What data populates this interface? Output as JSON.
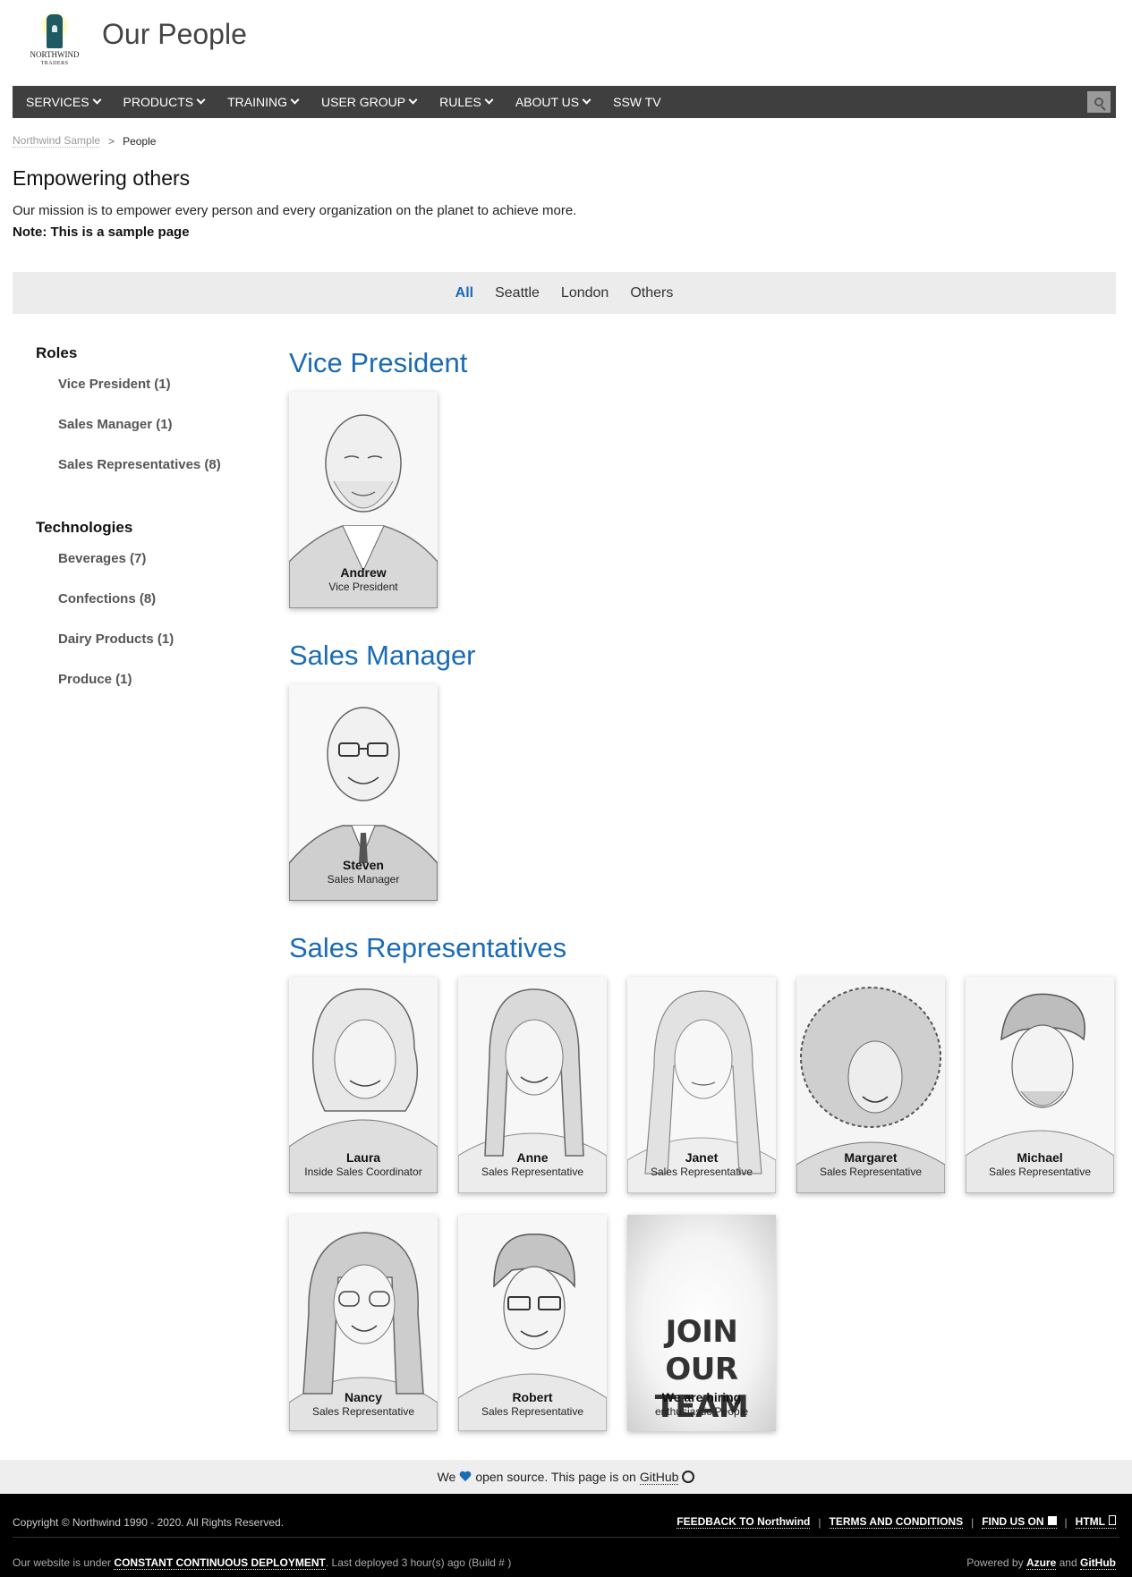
{
  "header": {
    "logo_text": "NORTHWIND",
    "logo_sub": "TRADERS",
    "site_title": "Our People"
  },
  "nav": {
    "items": [
      {
        "label": "SERVICES",
        "dropdown": true
      },
      {
        "label": "PRODUCTS",
        "dropdown": true
      },
      {
        "label": "TRAINING",
        "dropdown": true
      },
      {
        "label": "USER GROUP",
        "dropdown": true
      },
      {
        "label": "RULES",
        "dropdown": true
      },
      {
        "label": "ABOUT US",
        "dropdown": true
      },
      {
        "label": "SSW TV",
        "dropdown": false
      }
    ],
    "search_icon": "search-icon"
  },
  "breadcrumb": {
    "root": "Northwind Sample",
    "separator": ">",
    "current": "People"
  },
  "intro": {
    "heading": "Empowering others",
    "text": "Our mission is to empower every person and every organization on the planet to achieve more.",
    "note": "Note: This is a sample page"
  },
  "filters": {
    "items": [
      "All",
      "Seattle",
      "London",
      "Others"
    ],
    "active": "All"
  },
  "sidebar": {
    "roles_heading": "Roles",
    "roles": [
      "Vice President (1)",
      "Sales Manager (1)",
      "Sales Representatives (8)"
    ],
    "tech_heading": "Technologies",
    "technologies": [
      "Beverages (7)",
      "Confections (8)",
      "Dairy Products (1)",
      "Produce (1)"
    ]
  },
  "sections": {
    "vp": {
      "title": "Vice President",
      "people": [
        {
          "name": "Andrew",
          "role": "Vice President"
        }
      ]
    },
    "sm": {
      "title": "Sales Manager",
      "people": [
        {
          "name": "Steven",
          "role": "Sales Manager"
        }
      ]
    },
    "sr": {
      "title": "Sales Representatives",
      "people": [
        {
          "name": "Laura",
          "role": "Inside Sales Coordinator"
        },
        {
          "name": "Anne",
          "role": "Sales Representative"
        },
        {
          "name": "Janet",
          "role": "Sales Representative"
        },
        {
          "name": "Margaret",
          "role": "Sales Representative"
        },
        {
          "name": "Michael",
          "role": "Sales Representative"
        },
        {
          "name": "Nancy",
          "role": "Sales Representative"
        },
        {
          "name": "Robert",
          "role": "Sales Representative"
        }
      ],
      "join": {
        "title": "JOIN OUR TEAM",
        "name": "We are hiring",
        "role": "enthusiastic People"
      }
    }
  },
  "footer": {
    "open_source_pre": "We",
    "open_source_mid": "open source. This page is on",
    "open_source_link": "GitHub",
    "copyright": "Copyright © Northwind 1990 - 2020. All Rights Reserved.",
    "links": [
      "FEEDBACK TO Northwind",
      "TERMS AND CONDITIONS",
      "FIND US ON",
      "HTML"
    ],
    "link_separator": "|",
    "deploy_pre": "Our website is under",
    "deploy_link": "CONSTANT CONTINUOUS DEPLOYMENT",
    "deploy_post": ". Last deployed 3 hour(s) ago (Build # )",
    "powered_pre": "Powered by",
    "powered_azure": "Azure",
    "powered_and": "and",
    "powered_github": "GitHub"
  },
  "colors": {
    "accent": "#1a6bb5",
    "nav_bg": "#3f3f3f",
    "footer_bg": "#000000"
  }
}
